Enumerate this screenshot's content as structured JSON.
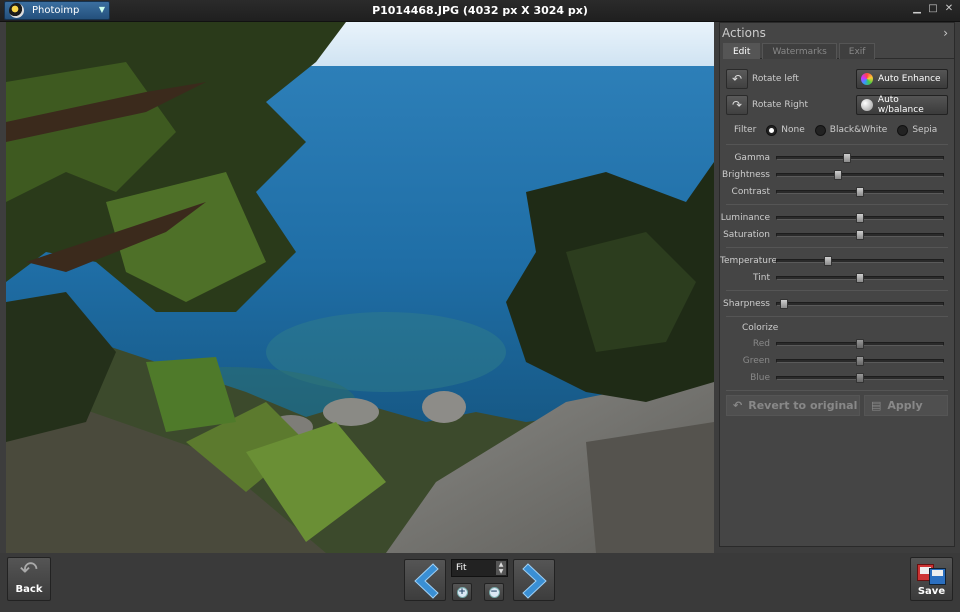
{
  "app": {
    "name": "Photoimp"
  },
  "window": {
    "title": "P1014468.JPG (4032 px X 3024 px)"
  },
  "actions_panel": {
    "header": "Actions",
    "tabs": [
      {
        "label": "Edit"
      },
      {
        "label": "Watermarks"
      },
      {
        "label": "Exif"
      }
    ],
    "rotate_left": "Rotate left",
    "rotate_right": "Rotate Right",
    "auto_enhance": "Auto Enhance",
    "auto_wbalance": "Auto w/balance",
    "filter": {
      "label": "Filter",
      "options": [
        "None",
        "Black&White",
        "Sepia"
      ],
      "selected": "None"
    },
    "sliders": {
      "gamma": {
        "label": "Gamma",
        "value": 0.42
      },
      "brightness": {
        "label": "Brightness",
        "value": 0.37
      },
      "contrast": {
        "label": "Contrast",
        "value": 0.5
      },
      "luminance": {
        "label": "Luminance",
        "value": 0.5
      },
      "saturation": {
        "label": "Saturation",
        "value": 0.5
      },
      "temperature": {
        "label": "Temperature",
        "value": 0.31
      },
      "tint": {
        "label": "Tint",
        "value": 0.5
      },
      "sharpness": {
        "label": "Sharpness",
        "value": 0.04
      }
    },
    "colorize": {
      "label": "Colorize",
      "red": {
        "label": "Red",
        "value": 0.5
      },
      "green": {
        "label": "Green",
        "value": 0.5
      },
      "blue": {
        "label": "Blue",
        "value": 0.5
      }
    },
    "revert": "Revert to original",
    "apply": "Apply"
  },
  "bottom": {
    "back": "Back",
    "zoom": "Fit",
    "save": "Save"
  }
}
